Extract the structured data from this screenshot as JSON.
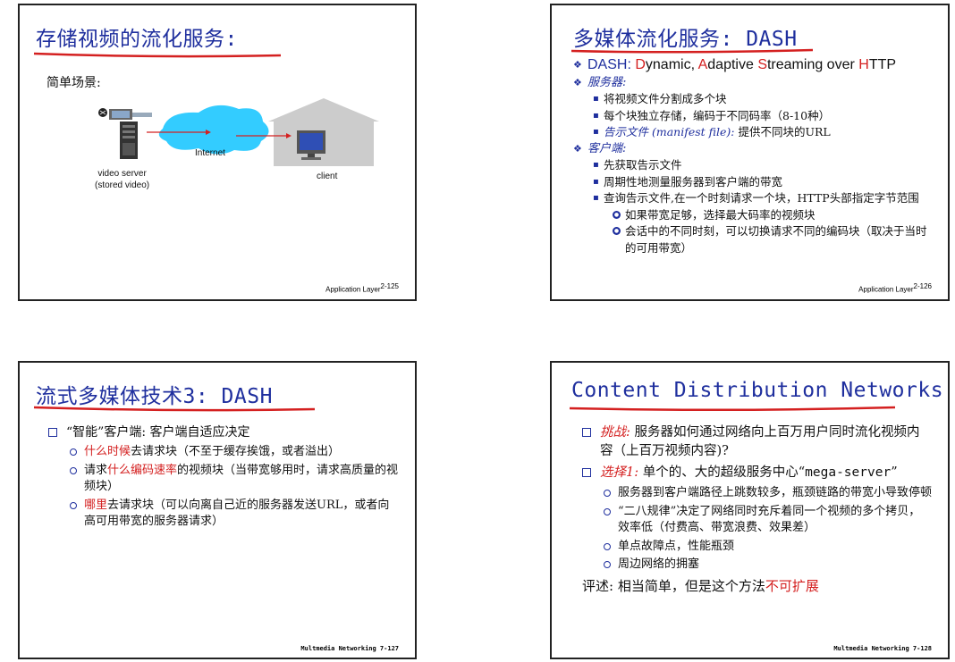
{
  "slide1": {
    "title": "存储视频的流化服务:",
    "subtitle": "简单场景:",
    "internet_label": "Internet",
    "server_label_1": "video server",
    "server_label_2": "(stored video)",
    "client_label": "client",
    "footer_text": "Application Layer",
    "footer_num": "2-125"
  },
  "slide2": {
    "title": "多媒体流化服务: DASH",
    "dash_D": "D",
    "dash_ynamic": "ynamic, ",
    "dash_A": "A",
    "dash_daptive": "daptive ",
    "dash_S": "S",
    "dash_treaming": "treaming over ",
    "dash_H": "H",
    "dash_TTP": "TTP",
    "dash_prefix": "DASH: ",
    "server_head": "服务器:",
    "server_items": [
      "将视频文件分割成多个块",
      "每个块独立存储，编码于不同码率（8-10种）"
    ],
    "manifest_it": "告示文件 (manifest file):",
    "manifest_rest": " 提供不同块的URL",
    "client_head": "客户端:",
    "client_items": [
      "先获取告示文件",
      "周期性地测量服务器到客户端的带宽",
      "查询告示文件,在一个时刻请求一个块，HTTP头部指定字节范围"
    ],
    "client_sub": [
      "如果带宽足够，选择最大码率的视频块",
      "会话中的不同时刻，可以切换请求不同的编码块（取决于当时的可用带宽）"
    ],
    "footer_text": "Application Layer",
    "footer_num": "2-126"
  },
  "slide3": {
    "title": "流式多媒体技术3: DASH",
    "main": "“智能”客户端: 客户端自适应决定",
    "sub1_red": "什么时候",
    "sub1_rest": "去请求块（不至于缓存挨饿，或者溢出）",
    "sub2_a": "请求",
    "sub2_red": "什么编码速率",
    "sub2_rest": "的视频块（当带宽够用时，请求高质量的视频块）",
    "sub3_red": "哪里",
    "sub3_rest": "去请求块（可以向离自己近的服务器发送URL，或者向高可用带宽的服务器请求）",
    "footer": "Multmedia Networking  7-127"
  },
  "slide4": {
    "title": "Content Distribution Networks",
    "challenge_label": "挑战:",
    "challenge_text": " 服务器如何通过网络向上百万用户同时流化视频内容（上百万视频内容)?",
    "option_label": "选择1:",
    "option_text_a": " 单个的、大的超级服务中心“",
    "option_text_mono": "mega-server",
    "option_text_b": "”",
    "subs": [
      "服务器到客户端路径上跳数较多，瓶颈链路的带宽小导致停顿",
      "“二八规律”决定了网络同时充斥着同一个视频的多个拷贝，效率低（付费高、带宽浪费、效果差）",
      "单点故障点，性能瓶颈",
      "周边网络的拥塞"
    ],
    "comment_a": "评述: 相当简单，但是这个方法",
    "comment_red": "不可扩展",
    "footer": "Multmedia Networking  7-128"
  },
  "colors": {
    "title_blue": "#1f2f9e",
    "accent_red": "#d42020",
    "cloud": "#33ccff",
    "house": "#cccccc"
  }
}
